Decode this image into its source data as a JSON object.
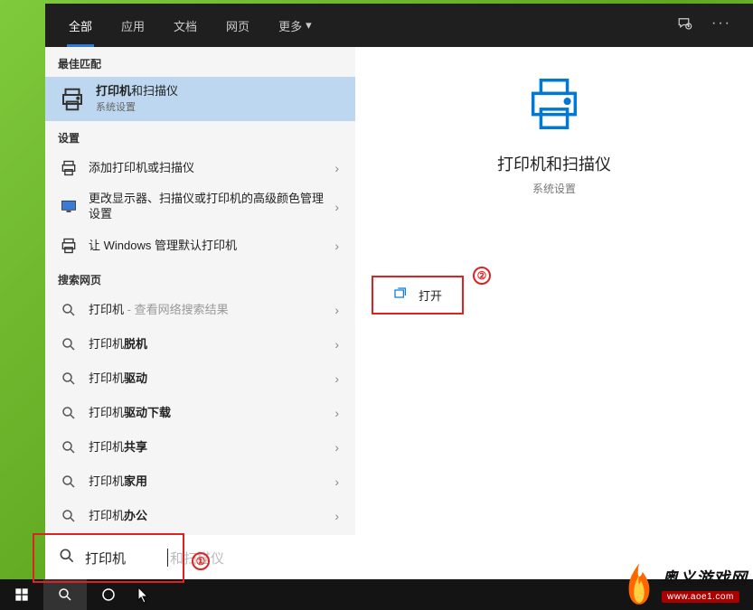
{
  "tabs": {
    "all": "全部",
    "apps": "应用",
    "docs": "文档",
    "web": "网页",
    "more": "更多"
  },
  "sections": {
    "best_match": "最佳匹配",
    "settings": "设置",
    "search_web": "搜索网页"
  },
  "best_match": {
    "title_prefix": "打印机",
    "title_suffix": "和扫描仪",
    "subtitle": "系统设置"
  },
  "settings_items": [
    {
      "label": "添加打印机或扫描仪",
      "icon": "printer"
    },
    {
      "label": "更改显示器、扫描仪或打印机的高级颜色管理设置",
      "icon": "monitor"
    },
    {
      "label": "让 Windows 管理默认打印机",
      "icon": "printer"
    }
  ],
  "web_items": [
    {
      "prefix": "打印机",
      "suffix": " - 查看网络搜索结果"
    },
    {
      "prefix": "打印机",
      "suffix": "脱机"
    },
    {
      "prefix": "打印机",
      "suffix": "驱动"
    },
    {
      "prefix": "打印机",
      "suffix": "驱动下载"
    },
    {
      "prefix": "打印机",
      "suffix": "共享"
    },
    {
      "prefix": "打印机",
      "suffix": "家用"
    },
    {
      "prefix": "打印机",
      "suffix": "办公"
    }
  ],
  "preview": {
    "title": "打印机和扫描仪",
    "subtitle": "系统设置",
    "open": "打开"
  },
  "search": {
    "value": "打印机",
    "placeholder": "和扫描仪"
  },
  "annotations": {
    "one": "①",
    "two": "②"
  },
  "watermark": {
    "cn": "奥义游戏网",
    "url": "www.aoe1.com"
  }
}
